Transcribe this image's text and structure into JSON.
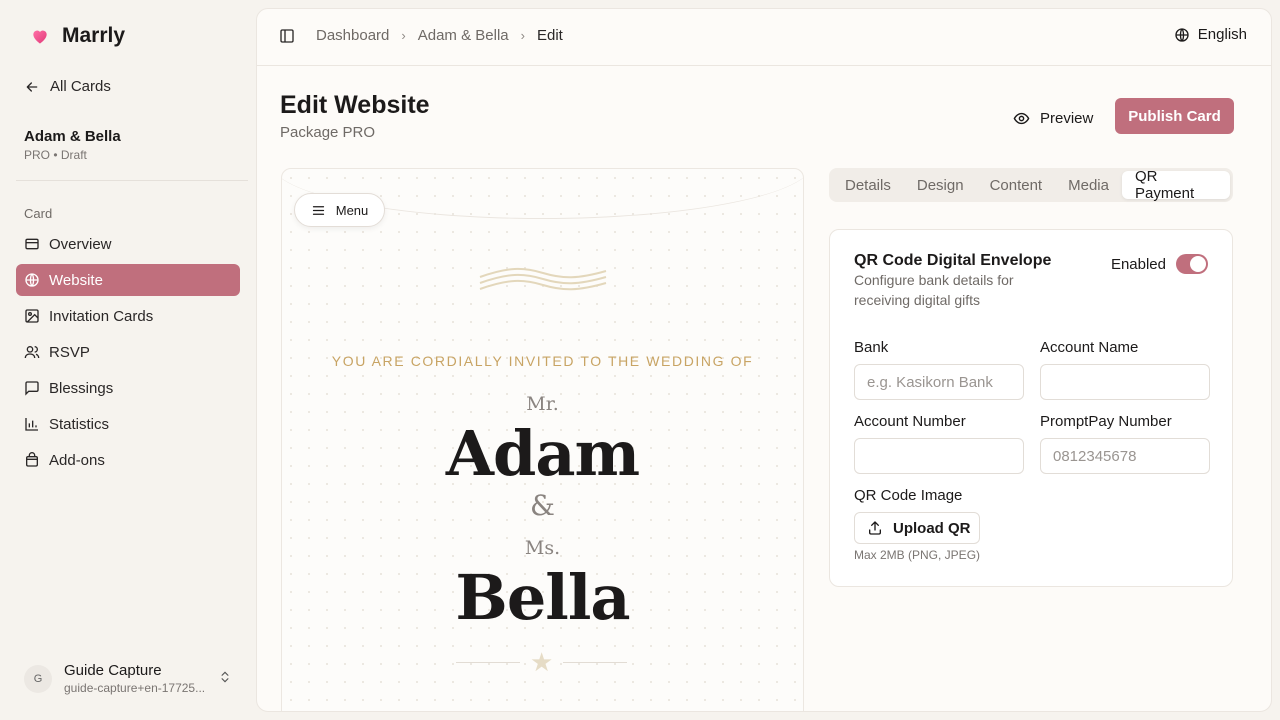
{
  "brand": {
    "name": "Marrly"
  },
  "sidebar": {
    "back_label": "All Cards",
    "project": {
      "name": "Adam & Bella",
      "meta": "PRO • Draft"
    },
    "section_label": "Card",
    "items": [
      {
        "label": "Overview",
        "icon": "card-icon"
      },
      {
        "label": "Website",
        "icon": "globe-icon",
        "active": true
      },
      {
        "label": "Invitation Cards",
        "icon": "image-icon"
      },
      {
        "label": "RSVP",
        "icon": "users-icon"
      },
      {
        "label": "Blessings",
        "icon": "message-icon"
      },
      {
        "label": "Statistics",
        "icon": "chart-icon"
      },
      {
        "label": "Add-ons",
        "icon": "bag-icon"
      }
    ],
    "user": {
      "initial": "G",
      "name": "Guide Capture",
      "email": "guide-capture+en-17725..."
    }
  },
  "topbar": {
    "breadcrumbs": [
      "Dashboard",
      "Adam & Bella",
      "Edit"
    ],
    "language": "English"
  },
  "page": {
    "title": "Edit Website",
    "subtitle": "Package PRO",
    "preview_label": "Preview",
    "publish_label": "Publish Card"
  },
  "preview_card": {
    "menu_label": "Menu",
    "invite_line": "YOU ARE CORDIALLY INVITED TO THE WEDDING OF",
    "groom_title": "Mr.",
    "groom_name": "Adam",
    "ampersand": "&",
    "bride_title": "Ms.",
    "bride_name": "Bella",
    "star": "★"
  },
  "tabs": [
    "Details",
    "Design",
    "Content",
    "Media",
    "QR Payment"
  ],
  "active_tab": "QR Payment",
  "qr_card": {
    "title": "QR Code Digital Envelope",
    "description": "Configure bank details for receiving digital gifts",
    "enabled_label": "Enabled",
    "enabled": true,
    "fields": {
      "bank": {
        "label": "Bank",
        "value": "",
        "placeholder": "e.g. Kasikorn Bank"
      },
      "account_name": {
        "label": "Account Name",
        "value": "",
        "placeholder": ""
      },
      "account_number": {
        "label": "Account Number",
        "value": "",
        "placeholder": ""
      },
      "promptpay": {
        "label": "PromptPay Number",
        "value": "",
        "placeholder": "0812345678"
      }
    },
    "qr_image_label": "QR Code Image",
    "upload_label": "Upload QR",
    "hint": "Max 2MB (PNG, JPEG)"
  },
  "colors": {
    "accent": "#c06f7d",
    "gold": "#c8a464",
    "background": "#f6f3ee"
  }
}
